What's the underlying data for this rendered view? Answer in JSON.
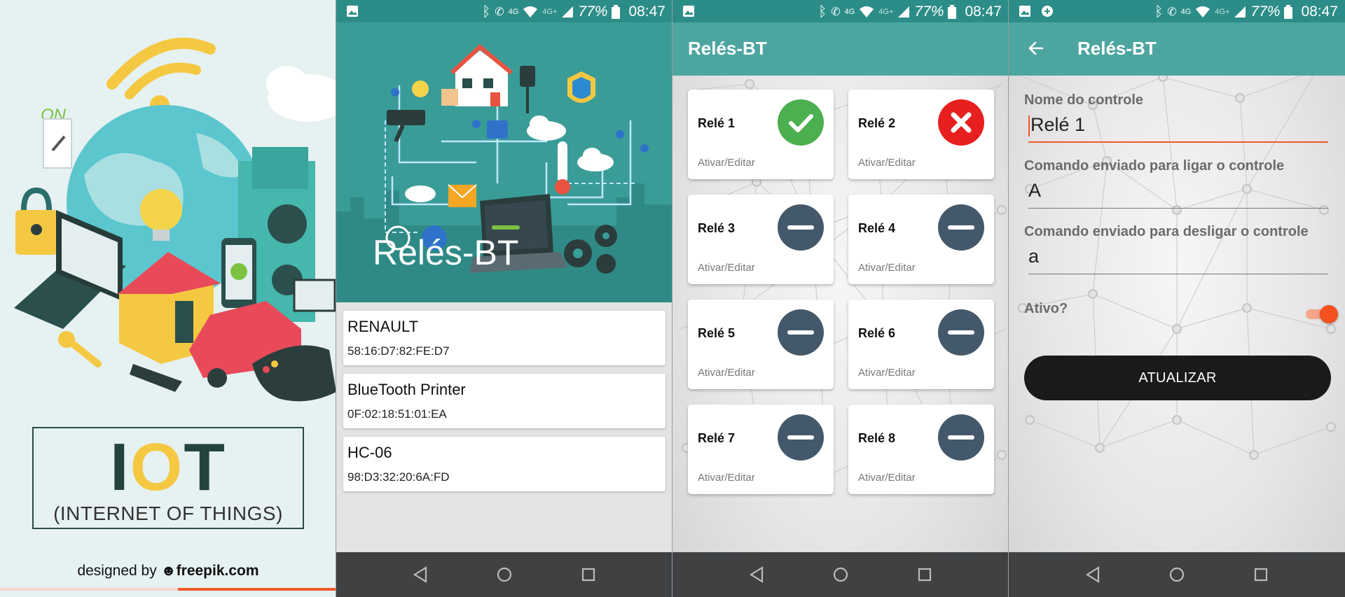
{
  "status": {
    "battery_pct": "77%",
    "time": "08:47",
    "network": "4G",
    "network2": "4G+"
  },
  "poster": {
    "on_label": "ON",
    "iot_letters": [
      "I",
      "O",
      "T"
    ],
    "subtitle": "(INTERNET OF THINGS)",
    "credit_prefix": "designed by",
    "credit_brand": "freepik.com"
  },
  "device_list": {
    "hero_title": "Relés-BT",
    "devices": [
      {
        "name": "RENAULT",
        "address": "58:16:D7:82:FE:D7"
      },
      {
        "name": "BlueTooth Printer",
        "address": "0F:02:18:51:01:EA"
      },
      {
        "name": "HC-06",
        "address": "98:D3:32:20:6A:FD"
      }
    ]
  },
  "relays_screen": {
    "app_title": "Relés-BT",
    "relays": [
      {
        "name": "Relé 1",
        "action": "Ativar/Editar",
        "state": "on"
      },
      {
        "name": "Relé 2",
        "action": "Ativar/Editar",
        "state": "off"
      },
      {
        "name": "Relé 3",
        "action": "Ativar/Editar",
        "state": "none"
      },
      {
        "name": "Relé 4",
        "action": "Ativar/Editar",
        "state": "none"
      },
      {
        "name": "Relé 5",
        "action": "Ativar/Editar",
        "state": "none"
      },
      {
        "name": "Relé 6",
        "action": "Ativar/Editar",
        "state": "none"
      },
      {
        "name": "Relé 7",
        "action": "Ativar/Editar",
        "state": "none"
      },
      {
        "name": "Relé 8",
        "action": "Ativar/Editar",
        "state": "none"
      }
    ]
  },
  "edit_screen": {
    "app_title": "Relés-BT",
    "name_label": "Nome do controle",
    "name_value": "Relé 1",
    "on_cmd_label": "Comando enviado para ligar o controle",
    "on_cmd_value": "A",
    "off_cmd_label": "Comando enviado para desligar o controle",
    "off_cmd_value": "a",
    "active_label": "Ativo?",
    "active": true,
    "update_button": "ATUALIZAR"
  },
  "colors": {
    "teal_status": "#2c8d88",
    "teal_appbar": "#4da5a0",
    "accent_orange": "#f15a24",
    "relay_on": "#4caf50",
    "relay_off": "#e81f1f",
    "relay_none": "#44586b"
  },
  "icons": [
    "image-icon",
    "bluetooth-icon",
    "phone-icon",
    "wifi-icon",
    "signal-icon",
    "battery-icon",
    "back-triangle-icon",
    "home-circle-icon",
    "recents-square-icon",
    "arrow-back-icon",
    "check-icon",
    "close-icon",
    "minus-icon"
  ]
}
